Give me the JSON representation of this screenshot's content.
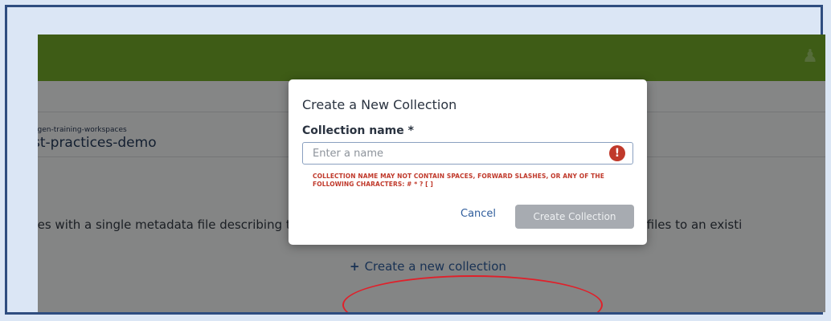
{
  "workspace": {
    "breadcrumb": "agen-training-workspaces",
    "title": "st-practices-demo"
  },
  "main": {
    "description": "files with a single metadata file describing the table structure. You can create a new collection, or add files to an existi",
    "create_link_plus": "+",
    "create_link_label": "Create a new collection"
  },
  "modal": {
    "title": "Create a New Collection",
    "field_label": "Collection name *",
    "input_placeholder": "Enter a name",
    "input_value": "",
    "error_icon": "!",
    "error_message": "COLLECTION NAME MAY NOT CONTAIN SPACES, FORWARD SLASHES, OR ANY OF THE FOLLOWING CHARACTERS: # * ? [ ]",
    "cancel_label": "Cancel",
    "create_label": "Create Collection"
  },
  "colors": {
    "header_green": "#74ab2a",
    "error_red": "#c0392b",
    "link_blue": "#2f5d9c",
    "highlight_red": "#e0202a",
    "frame_blue": "#2f4d80"
  },
  "icons": {
    "header": "user-icon",
    "error": "exclamation-circle-icon",
    "plus": "plus-icon"
  }
}
